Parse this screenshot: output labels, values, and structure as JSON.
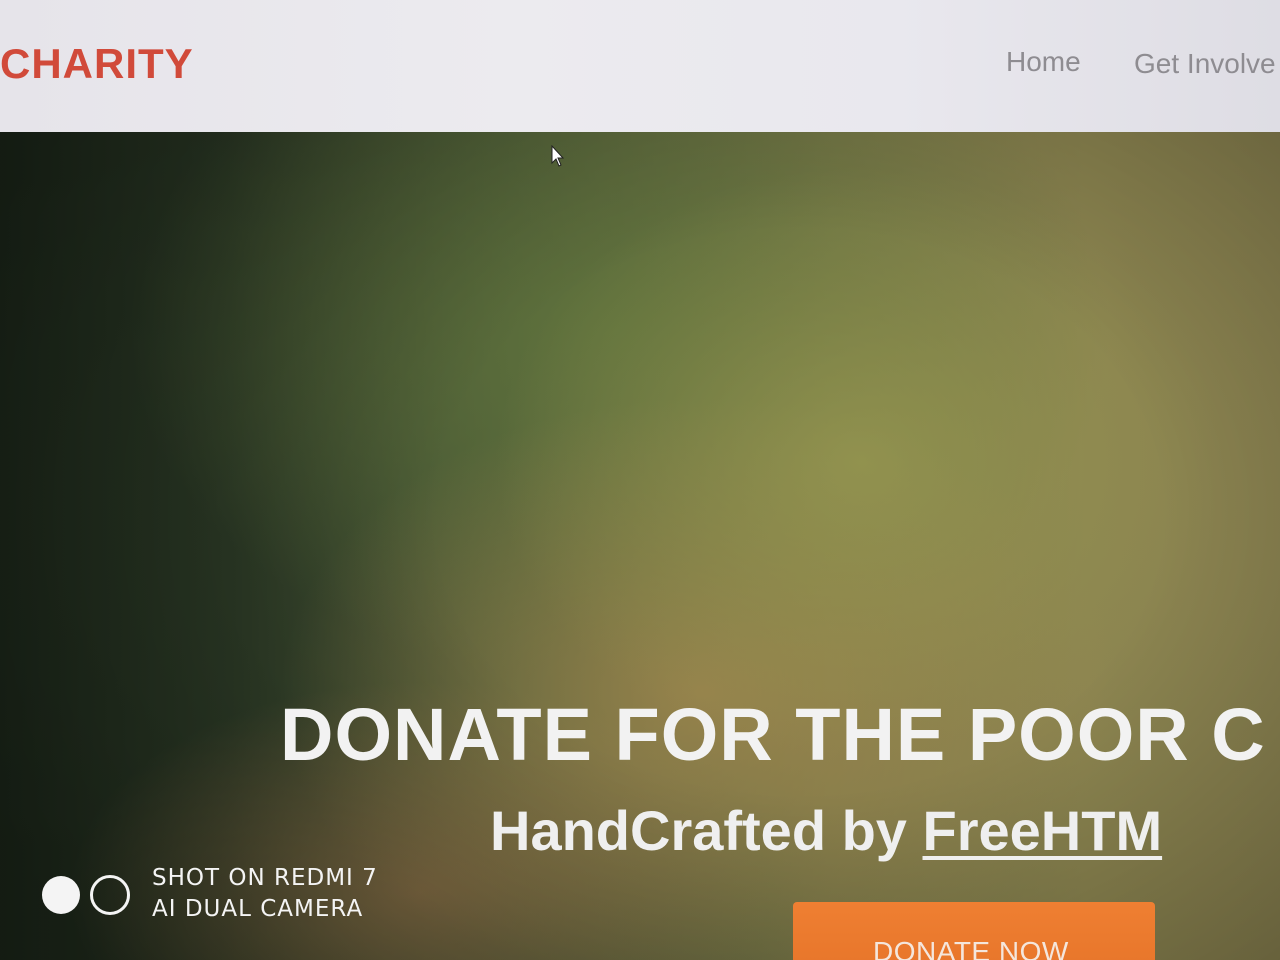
{
  "navbar": {
    "brand": "CHARITY",
    "links": [
      {
        "label": "Home"
      },
      {
        "label": "Get Involve"
      }
    ]
  },
  "hero": {
    "title": "DONATE FOR THE POOR C",
    "subtitle_prefix": "HandCrafted by ",
    "subtitle_link": "FreeHTM",
    "button_label": "DONATE NOW"
  },
  "watermark": {
    "line1": "SHOT ON REDMI 7",
    "line2": "AI DUAL CAMERA"
  },
  "colors": {
    "brand": "#d14a3a",
    "nav_text": "#8e8c91",
    "button": "#ef7f32",
    "hero_text": "#f2f2f2"
  },
  "icons": {
    "cursor": "mouse-pointer-icon"
  }
}
